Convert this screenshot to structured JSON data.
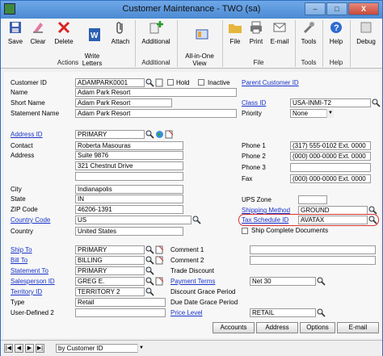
{
  "window": {
    "title": "Customer Maintenance  -  TWO (sa)",
    "minimize": "–",
    "maximize": "□",
    "close": "X"
  },
  "ribbon": {
    "save": "Save",
    "clear": "Clear",
    "delete": "Delete",
    "write_letters": "Write\nLetters",
    "attach": "Attach",
    "additional": "Additional",
    "all_in_one_view": "All-in-One\nView",
    "file": "File",
    "print": "Print",
    "email": "E-mail",
    "tools": "Tools",
    "help": "Help",
    "debug": "Debug",
    "group_actions": "Actions",
    "group_additional": "Additional",
    "group_file": "File",
    "group_tools": "Tools",
    "group_help": "Help"
  },
  "form": {
    "customer_id_label": "Customer ID",
    "customer_id": "ADAMPARK0001",
    "hold_label": "Hold",
    "inactive_label": "Inactive",
    "parent_customer_id": "Parent Customer ID",
    "name_label": "Name",
    "name": "Adam Park Resort",
    "short_name_label": "Short Name",
    "short_name": "Adam Park Resort",
    "statement_name_label": "Statement Name",
    "statement_name": "Adam Park Resort",
    "class_id_label": "Class ID",
    "class_id": "USA-INMI-T2",
    "priority_label": "Priority",
    "priority": "None",
    "address_id_label": "Address ID",
    "address_id": "PRIMARY",
    "contact_label": "Contact",
    "contact": "Roberta Masouras",
    "address_label": "Address",
    "address1": "Suite 9876",
    "address2": "321 Chestnut Drive",
    "address3": "",
    "city_label": "City",
    "city": "Indianapolis",
    "state_label": "State",
    "state": "IN",
    "zip_label": "ZIP Code",
    "zip": "46206-1391",
    "country_code_label": "Country Code",
    "country_code": "US",
    "country_label": "Country",
    "country": "United States",
    "phone1_label": "Phone 1",
    "phone1": "(317) 555-0102  Ext. 0000",
    "phone2_label": "Phone 2",
    "phone2": "(000) 000-0000  Ext. 0000",
    "phone3_label": "Phone 3",
    "phone3": "",
    "fax_label": "Fax",
    "fax": "(000) 000-0000  Ext. 0000",
    "ups_zone_label": "UPS Zone",
    "ups_zone": "",
    "shipping_method_label": "Shipping Method",
    "shipping_method": "GROUND",
    "tax_schedule_label": "Tax Schedule ID",
    "tax_schedule": "AVATAX",
    "ship_complete_label": "Ship Complete Documents",
    "ship_to_label": "Ship To",
    "ship_to": "PRIMARY",
    "bill_to_label": "Bill To",
    "bill_to": "BILLING",
    "statement_to_label": "Statement To",
    "statement_to": "PRIMARY",
    "salesperson_label": "Salesperson ID",
    "salesperson": "GREG E.",
    "territory_label": "Territory ID",
    "territory": "TERRITORY 2",
    "type_label": "Type",
    "type": "Retail",
    "user_defined2_label": "User-Defined 2",
    "user_defined2": "",
    "comment1_label": "Comment 1",
    "comment1": "",
    "comment2_label": "Comment 2",
    "comment2": "",
    "trade_discount_label": "Trade Discount",
    "payment_terms_label": "Payment Terms",
    "payment_terms": "Net 30",
    "discount_grace_label": "Discount Grace Period",
    "due_date_grace_label": "Due Date Grace Period",
    "price_level_label": "Price Level",
    "price_level": "RETAIL"
  },
  "buttons": {
    "accounts": "Accounts",
    "address": "Address",
    "options": "Options",
    "email": "E-mail"
  },
  "status": {
    "sort": "by Customer ID"
  }
}
